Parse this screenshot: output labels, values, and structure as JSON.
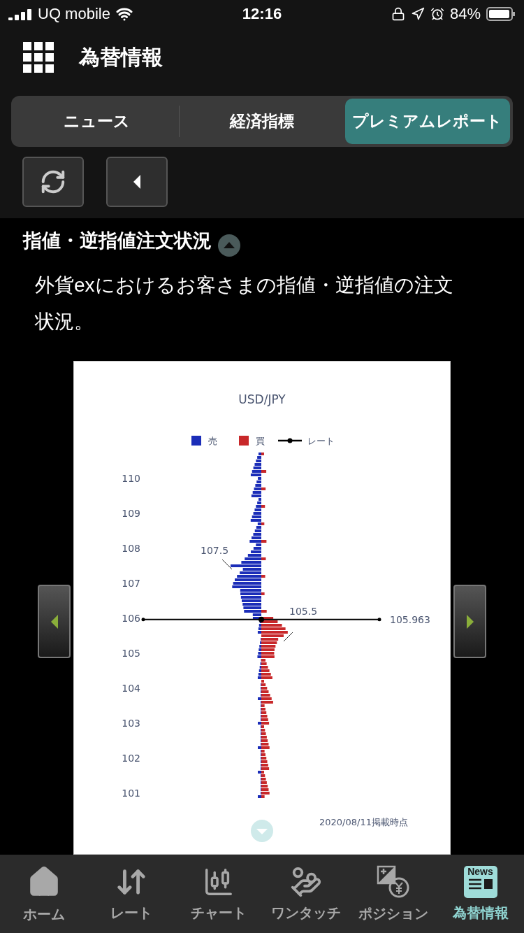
{
  "status_bar": {
    "carrier": "UQ mobile",
    "time": "12:16",
    "battery": "84%"
  },
  "header": {
    "title": "為替情報"
  },
  "tabs": [
    {
      "label": "ニュース",
      "selected": false
    },
    {
      "label": "経済指標",
      "selected": false
    },
    {
      "label": "プレミアムレポート",
      "selected": true
    }
  ],
  "section": {
    "title": "指値・逆指値注文状況",
    "expanded": true,
    "description": "外貨exにおけるお客さまの指値・逆指値の注文状況。"
  },
  "chart": {
    "title": "USD/JPY",
    "legend": [
      {
        "label": "売",
        "kind": "box",
        "color": "#1b2db8"
      },
      {
        "label": "買",
        "kind": "box",
        "color": "#c8282a"
      },
      {
        "label": "レート",
        "kind": "line",
        "color": "#000000"
      }
    ],
    "y_labels": [
      "110",
      "109",
      "108",
      "107",
      "106",
      "105",
      "104",
      "103",
      "102",
      "101"
    ],
    "annotations": [
      "107.5",
      "105.5"
    ],
    "rate_label": "105.963",
    "footnote": "2020/08/11掲載時点"
  },
  "nav": [
    {
      "label": "ホーム",
      "kind": "home",
      "selected": false
    },
    {
      "label": "レート",
      "kind": "rate",
      "selected": false
    },
    {
      "label": "チャート",
      "kind": "chart",
      "selected": false
    },
    {
      "label": "ワンタッチ",
      "kind": "onetouch",
      "selected": false
    },
    {
      "label": "ポジション",
      "kind": "position",
      "selected": false
    },
    {
      "label": "為替情報",
      "kind": "news",
      "selected": true,
      "icon_text": "News"
    }
  ]
}
